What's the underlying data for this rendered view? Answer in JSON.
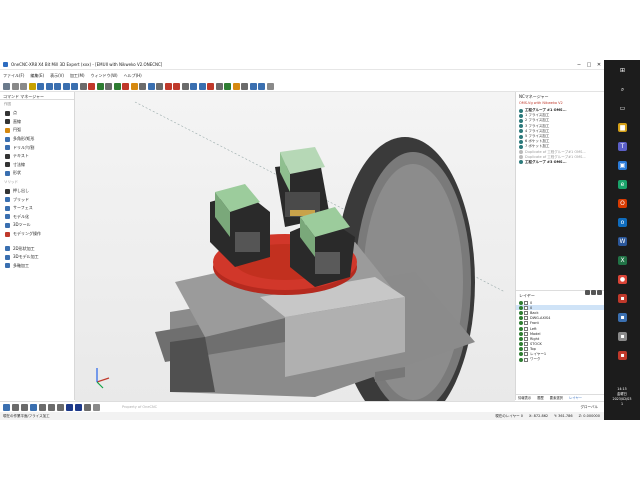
{
  "window": {
    "title": "OneCNC-XR8  X4 Bit Mill 3D Expert (xxx) - [EMUII with Nikweko V2.ONECNC]",
    "controls": [
      "─",
      "□",
      "✕"
    ]
  },
  "menu": [
    "ファイル(F)",
    "編集(E)",
    "表示(V)",
    "加工(M)",
    "ウィンドウ(W)",
    "ヘルプ(H)"
  ],
  "toolbar": {
    "icon_colors": [
      "#6b7b8c",
      "#8a8a8a",
      "#8a8a8a",
      "#c8a200",
      "#3a6fb0",
      "#3a6fb0",
      "#3a6fb0",
      "#3a6fb0",
      "#3a6fb0",
      "#6b6b6b",
      "#c0392b",
      "#2e7d32",
      "#6b6b6b",
      "#2e7d32",
      "#c0392b",
      "#d68910",
      "#6b6b6b",
      "#3a6fb0",
      "#6b6b6b",
      "#c0392b",
      "#c0392b",
      "#6b6b6b",
      "#3a6fb0",
      "#3a6fb0",
      "#c0392b",
      "#6b6b6b",
      "#2e7d32",
      "#d68910",
      "#6b6b6b",
      "#3a6fb0",
      "#3a6fb0",
      "#8a8a8a"
    ]
  },
  "left_panel": {
    "title": "コマンド マネージャー",
    "sections": [
      {
        "label": "作図",
        "items": [
          {
            "label": "点",
            "icon": "point-icon",
            "color": "#333"
          },
          {
            "label": "直線",
            "icon": "line-icon",
            "color": "#333"
          },
          {
            "label": "円弧",
            "icon": "arc-icon",
            "color": "#d68910"
          },
          {
            "label": "多角形/矩形",
            "icon": "polygon-icon",
            "color": "#3a6fb0"
          },
          {
            "label": "ドリル穴/割",
            "icon": "drill-icon",
            "color": "#3a6fb0"
          },
          {
            "label": "テキスト",
            "icon": "text-icon",
            "color": "#333"
          },
          {
            "label": "寸法線",
            "icon": "dimension-icon",
            "color": "#333"
          },
          {
            "label": "形状",
            "icon": "shape-icon",
            "color": "#3a6fb0"
          }
        ]
      },
      {
        "label": "ソリッド",
        "items": [
          {
            "label": "押し出し",
            "icon": "extrude-icon",
            "color": "#333"
          },
          {
            "label": "ブリッド",
            "icon": "grid-icon",
            "color": "#3a6fb0"
          },
          {
            "label": "サーフェス",
            "icon": "surface-icon",
            "color": "#3a6fb0"
          },
          {
            "label": "モデル化",
            "icon": "model-icon",
            "color": "#3a6fb0"
          },
          {
            "label": "3Dツール",
            "icon": "tool3d-icon",
            "color": "#3a6fb0"
          },
          {
            "label": "モデリング操作",
            "icon": "modeling-icon",
            "color": "#c0392b"
          }
        ]
      },
      {
        "label": "",
        "items": [
          {
            "label": "2D形状加工",
            "icon": "2d-machining-icon",
            "color": "#3a6fb0"
          },
          {
            "label": "3Dモデル加工",
            "icon": "3d-machining-icon",
            "color": "#3a6fb0"
          },
          {
            "label": "多軸加工",
            "icon": "multiaxis-icon",
            "color": "#3a6fb0"
          }
        ]
      }
    ]
  },
  "nc_manager": {
    "title": "NCマネージャー",
    "selected_label": "OMS-Vg with Nikweko V2",
    "rows": [
      {
        "label": "工程グループ #1 OMS...",
        "type": "group"
      },
      {
        "label": "1 フライス加工",
        "type": "op"
      },
      {
        "label": "2 フライス加工",
        "type": "op"
      },
      {
        "label": "3 フライス加工",
        "type": "op"
      },
      {
        "label": "4 フライス加工",
        "type": "op"
      },
      {
        "label": "5 フライス加工",
        "type": "op"
      },
      {
        "label": "6 ポケット加工",
        "type": "op"
      },
      {
        "label": "7 ポケット加工",
        "type": "op"
      },
      {
        "label": "Duplicate of 工程グループ#1 OMS...",
        "type": "dim"
      },
      {
        "label": "Duplicate of 工程グループ#1 OMS...",
        "type": "dim"
      },
      {
        "label": "工程グループ #3 OMS...",
        "type": "group"
      }
    ]
  },
  "layers": {
    "title": "レイヤー",
    "rows": [
      {
        "label": "0",
        "color": "#ffffff",
        "selected": false
      },
      {
        "label": "0",
        "color": "#ffffff",
        "selected": true
      },
      {
        "label": "Back",
        "color": "#ffffff",
        "selected": false
      },
      {
        "label": "DWG-AXIS4",
        "color": "#ffffff",
        "selected": false
      },
      {
        "label": "Front",
        "color": "#ffffff",
        "selected": false
      },
      {
        "label": "Left",
        "color": "#ffffff",
        "selected": false
      },
      {
        "label": "Model",
        "color": "#ffffff",
        "selected": false
      },
      {
        "label": "Right",
        "color": "#ffffff",
        "selected": false
      },
      {
        "label": "STOCK",
        "color": "#ffffff",
        "selected": false
      },
      {
        "label": "Top",
        "color": "#ffffff",
        "selected": false
      },
      {
        "label": "レイヤー1",
        "color": "#ffffff",
        "selected": false
      },
      {
        "label": "ワーク",
        "color": "#ffffff",
        "selected": false
      }
    ],
    "tabs": [
      "情報表示",
      "履歴",
      "要素選択",
      "レイヤー"
    ],
    "active_tab": 3
  },
  "bottom_bar": {
    "message": "Property of OneCNC",
    "right_label": "グローバル",
    "icon_colors": [
      "#3a6fb0",
      "#6b6b6b",
      "#6b6b6b",
      "#3a6fb0",
      "#6b6b6b",
      "#6b6b6b",
      "#6b6b6b",
      "#1e3a8a",
      "#1e3a8a",
      "#6b6b6b",
      "#8a8a8a"
    ]
  },
  "statusbar": {
    "left": "現在の作業平面/フライス加工",
    "layer": "現在のレイヤー 0",
    "x": "X: 872.862",
    "y": "Y: 361.786",
    "z": "Z: 0.000000"
  },
  "taskbar": {
    "icons": [
      {
        "name": "windows-start-icon",
        "glyph": "⊞",
        "color": "#1c1c1c"
      },
      {
        "name": "search-icon",
        "glyph": "⌕",
        "color": "#1c1c1c"
      },
      {
        "name": "task-view-icon",
        "glyph": "▭",
        "color": "#1c1c1c"
      },
      {
        "name": "file-explorer-icon",
        "glyph": "▆",
        "color": "#d4a017"
      },
      {
        "name": "teams-icon",
        "glyph": "T",
        "color": "#5b5fc7"
      },
      {
        "name": "store-icon",
        "glyph": "▣",
        "color": "#2b7bd8"
      },
      {
        "name": "edge-icon",
        "glyph": "e",
        "color": "#1aa36a"
      },
      {
        "name": "office-icon",
        "glyph": "O",
        "color": "#d83b01"
      },
      {
        "name": "outlook-icon",
        "glyph": "o",
        "color": "#0f6cbd"
      },
      {
        "name": "word-icon",
        "glyph": "W",
        "color": "#2b579a"
      },
      {
        "name": "excel-icon",
        "glyph": "X",
        "color": "#217346"
      },
      {
        "name": "chrome-icon",
        "glyph": "●",
        "color": "#db4437"
      },
      {
        "name": "app-icon-1",
        "glyph": "▪",
        "color": "#c0392b"
      },
      {
        "name": "app-icon-2",
        "glyph": "▪",
        "color": "#3a6fb0"
      },
      {
        "name": "app-icon-3",
        "glyph": "▪",
        "color": "#8a8a8a"
      },
      {
        "name": "app-icon-4",
        "glyph": "▪",
        "color": "#c0392b"
      }
    ],
    "time": "14:15",
    "day": "金曜日",
    "date": "2023/02/03",
    "notification_count": "1"
  }
}
